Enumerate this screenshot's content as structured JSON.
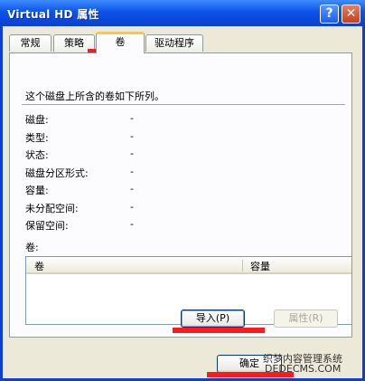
{
  "window": {
    "title": "Virtual HD 属性",
    "help_glyph": "?",
    "close_glyph": "✕"
  },
  "tabs": [
    {
      "label": "常规",
      "active": false
    },
    {
      "label": "策略",
      "active": false
    },
    {
      "label": "卷",
      "active": true
    },
    {
      "label": "驱动程序",
      "active": false
    }
  ],
  "panel": {
    "description": "这个磁盘上所含的卷如下所列。",
    "properties": [
      {
        "label": "磁盘:",
        "value": "-"
      },
      {
        "label": "类型:",
        "value": "-"
      },
      {
        "label": "状态:",
        "value": "-"
      },
      {
        "label": "磁盘分区形式:",
        "value": "-"
      },
      {
        "label": "容量:",
        "value": "-"
      },
      {
        "label": "未分配空间:",
        "value": "-"
      },
      {
        "label": "保留空间:",
        "value": "-"
      }
    ],
    "volumes_label": "卷:",
    "columns": [
      "卷",
      "容量"
    ],
    "import_button": "导入(P)",
    "properties_button": "属性(R)"
  },
  "footer": {
    "ok_button": "确定"
  },
  "watermark": {
    "line1": "织梦内容管理系统",
    "line2": "DEDECMS.COM"
  }
}
